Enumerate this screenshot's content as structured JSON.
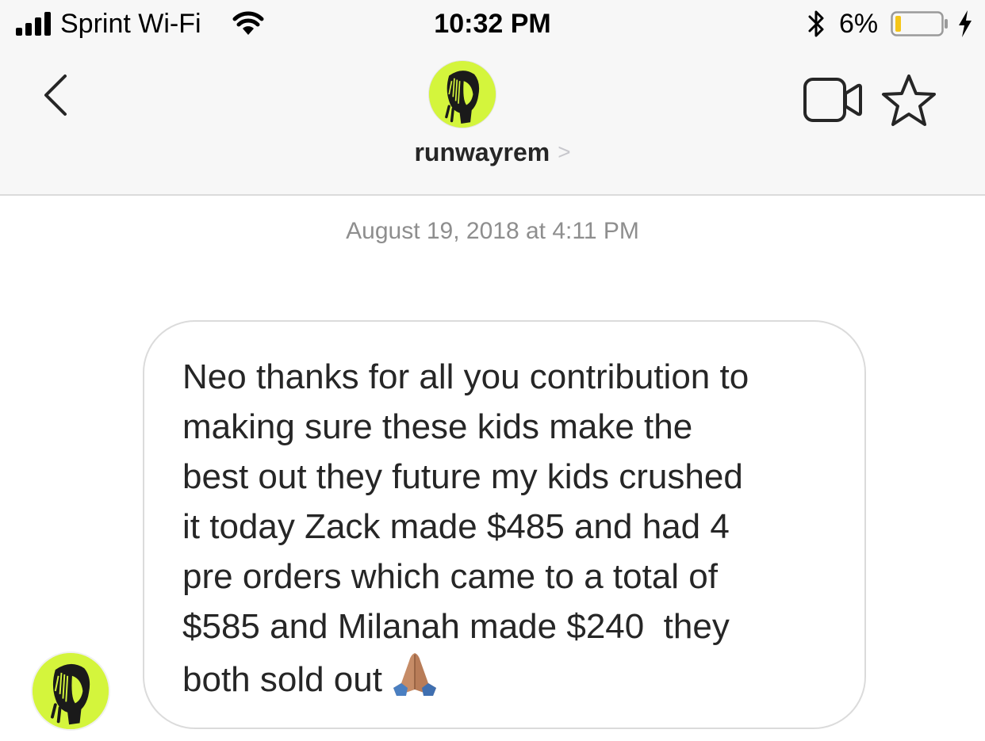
{
  "status_bar": {
    "carrier": "Sprint Wi-Fi",
    "time": "10:32 PM",
    "battery_percent": "6%",
    "battery_level": 0.06,
    "icons": [
      "signal-icon",
      "wifi-icon",
      "bluetooth-icon",
      "battery-icon",
      "charging-icon"
    ]
  },
  "header": {
    "back_icon": "chevron-left-icon",
    "avatar_icon": "profile-avatar",
    "username": "runwayrem",
    "username_chevron": ">",
    "video_icon": "video-camera-icon",
    "star_icon": "star-icon"
  },
  "conversation": {
    "timestamp": "August 19, 2018 at 4:11 PM",
    "messages": [
      {
        "text": "Neo thanks for all you contribution to\nmaking sure these kids make the\nbest out they future my kids crushed\nit today Zack made $485 and had 4\npre orders which came to a total of\n$585 and Milanah made $240  they\nboth sold out",
        "emoji": "folded-hands-emoji"
      }
    ]
  },
  "colors": {
    "header_bg": "#f7f7f7",
    "avatar_bg": "#d4f53c",
    "text": "#262626",
    "muted": "#8e8e8e",
    "border": "#dbdbdb"
  }
}
